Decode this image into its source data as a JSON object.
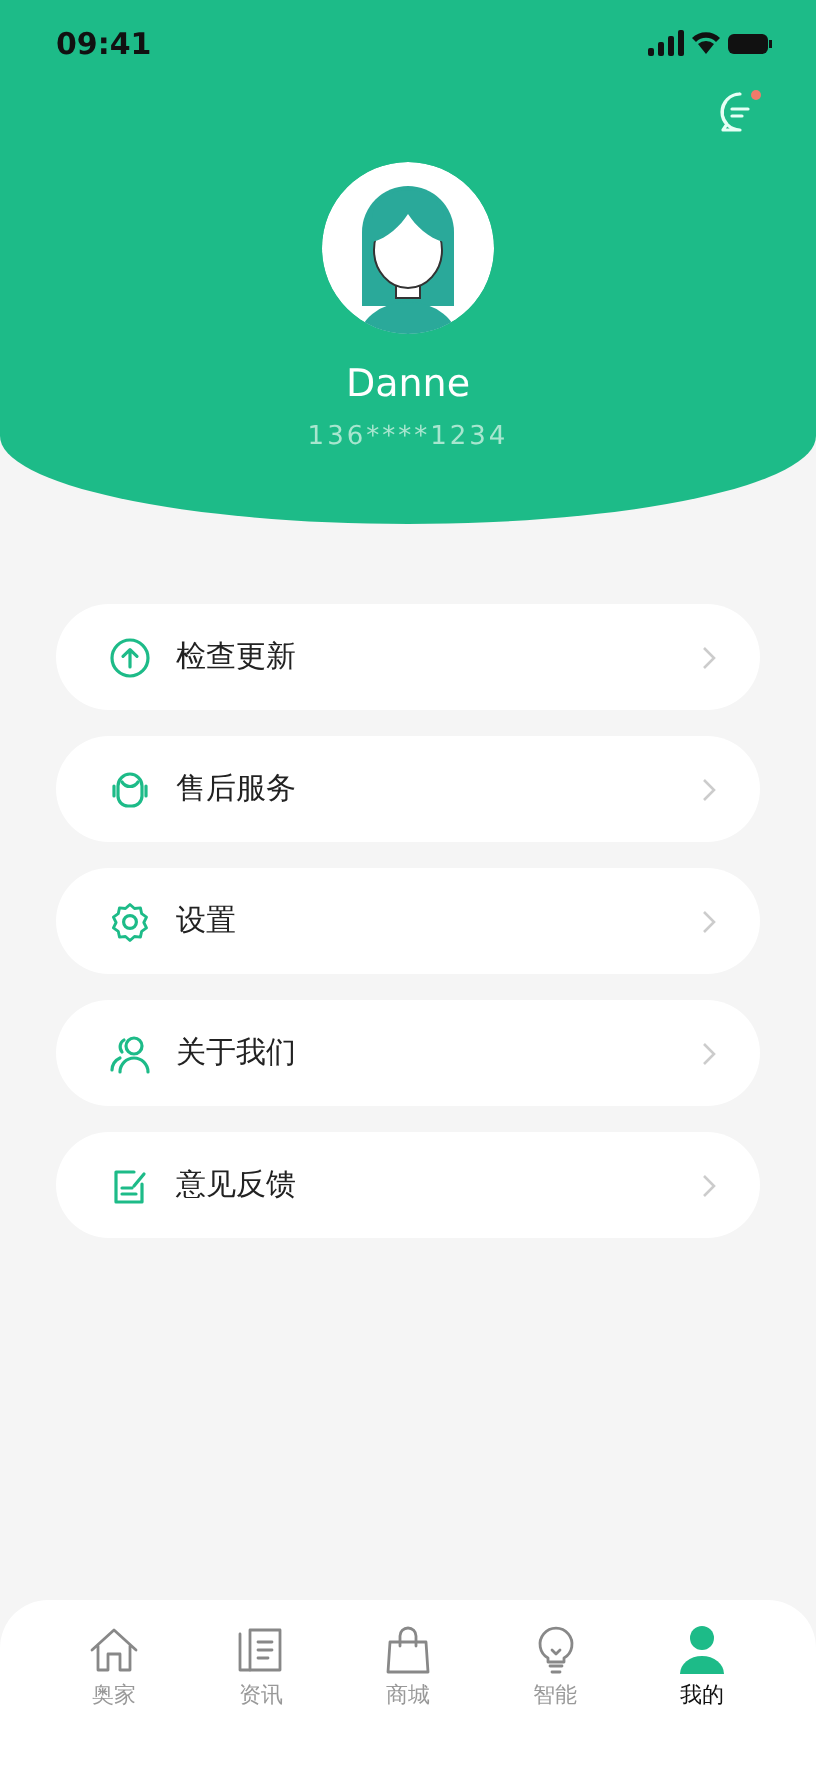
{
  "status_bar": {
    "time": "09:41"
  },
  "header": {
    "has_unread_messages": true
  },
  "profile": {
    "name": "Danne",
    "phone": "136****1234"
  },
  "menu": [
    {
      "kind": "update",
      "label": "检查更新"
    },
    {
      "kind": "service",
      "label": "售后服务"
    },
    {
      "kind": "settings",
      "label": "设置"
    },
    {
      "kind": "about",
      "label": "关于我们"
    },
    {
      "kind": "feedback",
      "label": "意见反馈"
    }
  ],
  "tabs": [
    {
      "kind": "home",
      "label": "奥家",
      "selected": false
    },
    {
      "kind": "news",
      "label": "资讯",
      "selected": false
    },
    {
      "kind": "shop",
      "label": "商城",
      "selected": false
    },
    {
      "kind": "smart",
      "label": "智能",
      "selected": false
    },
    {
      "kind": "me",
      "label": "我的",
      "selected": true
    }
  ]
}
